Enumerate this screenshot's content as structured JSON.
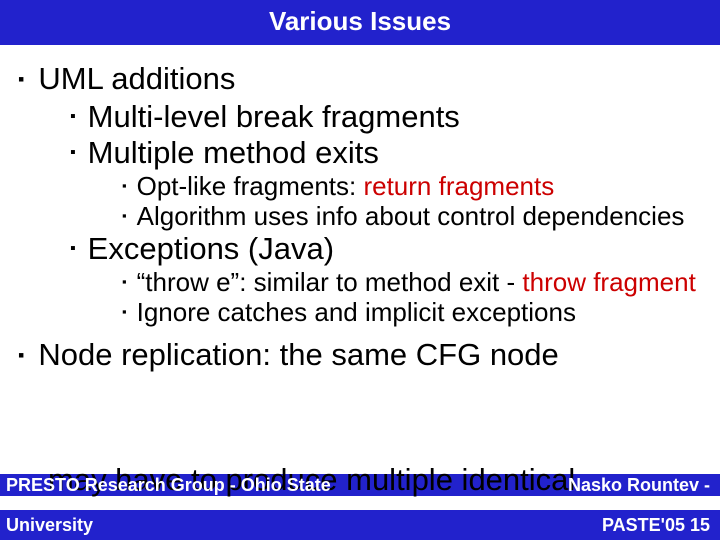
{
  "title": "Various Issues",
  "b1a": "UML additions",
  "b2a": "Multi-level break fragments",
  "b2b": "Multiple method exits",
  "b3a_pre": "Opt-like fragments: ",
  "b3a_red": "return fragments",
  "b3b": "Algorithm uses info about control dependencies",
  "b2c": "Exceptions (Java)",
  "b3c_pre": "“throw e”: similar to method exit - ",
  "b3c_red": "throw fragment",
  "b3d": "Ignore catches and implicit exceptions",
  "b1b": "Node replication: the same CFG node",
  "overlay_body": "may have to produce multiple identical",
  "footer_group_line1_left": "PREST",
  "footer_group_line1_mid": "O Research Group - Ohio State",
  "footer_university": "University",
  "footer_author": "Nasko Rountev -",
  "footer_page": "PASTE'05  15",
  "bullet": "▪"
}
